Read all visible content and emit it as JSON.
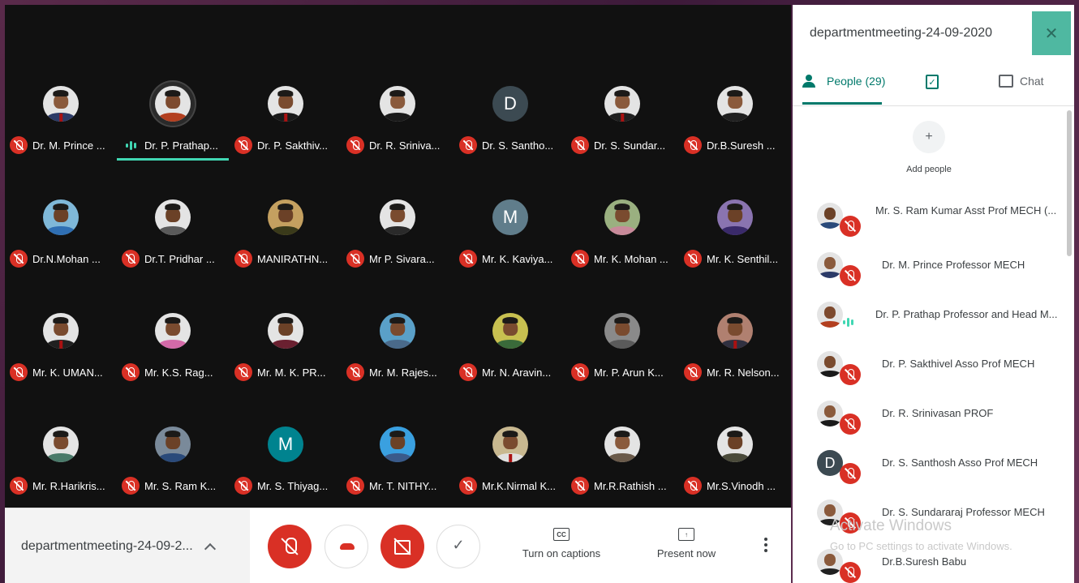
{
  "meeting": {
    "code_full": "departmentmeeting-24-09-2020",
    "code_short": "departmentmeeting-24-09-2..."
  },
  "grid": [
    {
      "name": "Dr. M. Prince ...",
      "avatar": {
        "type": "photo",
        "shirt": "#2b3a67",
        "skin": "#8a5a3c",
        "tie": true
      },
      "mic": "off"
    },
    {
      "name": "Dr. P. Prathap...",
      "avatar": {
        "type": "photo",
        "shirt": "#b33f1f",
        "skin": "#7d4a2e"
      },
      "mic": "speaking",
      "active": true
    },
    {
      "name": "Dr. P. Sakthiv...",
      "avatar": {
        "type": "photo",
        "shirt": "#1a1a1a",
        "skin": "#7a4b2f",
        "tie": true
      },
      "mic": "off"
    },
    {
      "name": "Dr. R. Sriniva...",
      "avatar": {
        "type": "photo",
        "shirt": "#1a1a1a",
        "skin": "#8a5a3c"
      },
      "mic": "off"
    },
    {
      "name": "Dr. S. Santho...",
      "avatar": {
        "type": "letter",
        "letter": "D",
        "color": "#3c4a52"
      },
      "mic": "off"
    },
    {
      "name": "Dr. S. Sundar...",
      "avatar": {
        "type": "photo",
        "shirt": "#202020",
        "skin": "#8a5a3c",
        "tie": true
      },
      "mic": "off"
    },
    {
      "name": "Dr.B.Suresh ...",
      "avatar": {
        "type": "photo",
        "shirt": "#202020",
        "skin": "#8a5a3c"
      },
      "mic": "off"
    },
    {
      "name": "Dr.N.Mohan ...",
      "avatar": {
        "type": "photo",
        "shirt": "#2f6fb3",
        "skin": "#6b4127",
        "bg": "#7fb8d8"
      },
      "mic": "off"
    },
    {
      "name": "Dr.T. Pridhar ...",
      "avatar": {
        "type": "photo",
        "shirt": "#5a5a5a",
        "skin": "#6b4127"
      },
      "mic": "off"
    },
    {
      "name": "MANIRATHN...",
      "avatar": {
        "type": "photo",
        "shirt": "#3a3a1a",
        "skin": "#6b4127",
        "bg": "#c4a060"
      },
      "mic": "off"
    },
    {
      "name": "Mr P. Sivara...",
      "avatar": {
        "type": "photo",
        "shirt": "#2a2a2a",
        "skin": "#7a4b2f"
      },
      "mic": "off"
    },
    {
      "name": "Mr. K. Kaviya...",
      "avatar": {
        "type": "letter",
        "letter": "M",
        "color": "#607d8b"
      },
      "mic": "off"
    },
    {
      "name": "Mr. K. Mohan ...",
      "avatar": {
        "type": "photo",
        "shirt": "#c88a9a",
        "skin": "#7a4b2f",
        "bg": "#9ab080"
      },
      "mic": "off"
    },
    {
      "name": "Mr. K. Senthil...",
      "avatar": {
        "type": "photo",
        "shirt": "#3a2a6a",
        "skin": "#6b4127",
        "bg": "#8a74b0"
      },
      "mic": "off"
    },
    {
      "name": "Mr. K. UMAN...",
      "avatar": {
        "type": "photo",
        "shirt": "#202020",
        "skin": "#7a4b2f",
        "tie": true
      },
      "mic": "off"
    },
    {
      "name": "Mr. K.S. Rag...",
      "avatar": {
        "type": "photo",
        "shirt": "#d36aa8",
        "skin": "#7a4b2f"
      },
      "mic": "off"
    },
    {
      "name": "Mr. M. K. PR...",
      "avatar": {
        "type": "photo",
        "shirt": "#6a2030",
        "skin": "#6b4127"
      },
      "mic": "off"
    },
    {
      "name": "Mr. M. Rajes...",
      "avatar": {
        "type": "photo",
        "shirt": "#4a6a8a",
        "skin": "#7a4b2f",
        "bg": "#5aa0c8"
      },
      "mic": "off"
    },
    {
      "name": "Mr. N. Aravin...",
      "avatar": {
        "type": "photo",
        "shirt": "#3a6a3a",
        "skin": "#7a4b2f",
        "bg": "#c8c050"
      },
      "mic": "off"
    },
    {
      "name": "Mr. P. Arun K...",
      "avatar": {
        "type": "photo",
        "shirt": "#5a5a5a",
        "skin": "#7a4b2f",
        "bg": "#8a8a8a"
      },
      "mic": "off"
    },
    {
      "name": "Mr. R. Nelson...",
      "avatar": {
        "type": "photo",
        "shirt": "#303040",
        "skin": "#7a4b2f",
        "bg": "#b08070",
        "tie": true
      },
      "mic": "off"
    },
    {
      "name": "Mr. R.Harikris...",
      "avatar": {
        "type": "photo",
        "shirt": "#4a7a6a",
        "skin": "#7a4b2f"
      },
      "mic": "off"
    },
    {
      "name": "Mr. S. Ram K...",
      "avatar": {
        "type": "photo",
        "shirt": "#2a4a7a",
        "skin": "#6b4127",
        "bg": "#7a8a9a"
      },
      "mic": "off"
    },
    {
      "name": "Mr. S. Thiyag...",
      "avatar": {
        "type": "letter",
        "letter": "M",
        "color": "#00838f"
      },
      "mic": "off"
    },
    {
      "name": "Mr. T. NITHY...",
      "avatar": {
        "type": "photo",
        "shirt": "#3a5a8a",
        "skin": "#6b4127",
        "bg": "#3aa0e0"
      },
      "mic": "off"
    },
    {
      "name": "Mr.K.Nirmal K...",
      "avatar": {
        "type": "photo",
        "shirt": "#e0e0e0",
        "skin": "#7a4b2f",
        "bg": "#c8b890",
        "tie": true
      },
      "mic": "off"
    },
    {
      "name": "Mr.R.Rathish ...",
      "avatar": {
        "type": "photo",
        "shirt": "#6a5a4a",
        "skin": "#8a5a3c"
      },
      "mic": "off"
    },
    {
      "name": "Mr.S.Vinodh ...",
      "avatar": {
        "type": "photo",
        "shirt": "#4a4a3a",
        "skin": "#6b4127"
      },
      "mic": "off"
    }
  ],
  "controls": {
    "captions_label": "Turn on captions",
    "captions_icon": "CC",
    "present_label": "Present now",
    "present_icon": "↑",
    "check_icon": "✓"
  },
  "side_panel": {
    "close_icon": "✕",
    "tabs": {
      "people": "People (29)",
      "chat": "Chat",
      "tasks_icon": "✓"
    },
    "add_people_label": "Add people",
    "add_people_icon": "+",
    "participants": [
      {
        "name": "Mr. S. Ram Kumar Asst Prof MECH (...",
        "avatar": {
          "type": "photo",
          "shirt": "#2a4a7a",
          "skin": "#6b4127"
        },
        "mic": "off"
      },
      {
        "name": "Dr. M. Prince Professor MECH",
        "avatar": {
          "type": "photo",
          "shirt": "#2b3a67",
          "skin": "#8a5a3c"
        },
        "mic": "off"
      },
      {
        "name": "Dr. P. Prathap Professor and Head M...",
        "avatar": {
          "type": "photo",
          "shirt": "#b33f1f",
          "skin": "#7d4a2e"
        },
        "mic": "speaking"
      },
      {
        "name": "Dr. P. Sakthivel Asso Prof MECH",
        "avatar": {
          "type": "photo",
          "shirt": "#1a1a1a",
          "skin": "#7a4b2f"
        },
        "mic": "off"
      },
      {
        "name": "Dr. R. Srinivasan PROF",
        "avatar": {
          "type": "photo",
          "shirt": "#1a1a1a",
          "skin": "#8a5a3c"
        },
        "mic": "off"
      },
      {
        "name": "Dr. S. Santhosh Asso Prof MECH",
        "avatar": {
          "type": "letter",
          "letter": "D"
        },
        "mic": "off"
      },
      {
        "name": "Dr. S. Sundararaj Professor MECH",
        "avatar": {
          "type": "photo",
          "shirt": "#202020",
          "skin": "#8a5a3c"
        },
        "mic": "off"
      },
      {
        "name": "Dr.B.Suresh Babu",
        "avatar": {
          "type": "photo",
          "shirt": "#202020",
          "skin": "#8a5a3c"
        },
        "mic": "off"
      }
    ]
  },
  "watermark": {
    "title": "Activate Windows",
    "subtitle": "Go to PC settings to activate Windows."
  }
}
